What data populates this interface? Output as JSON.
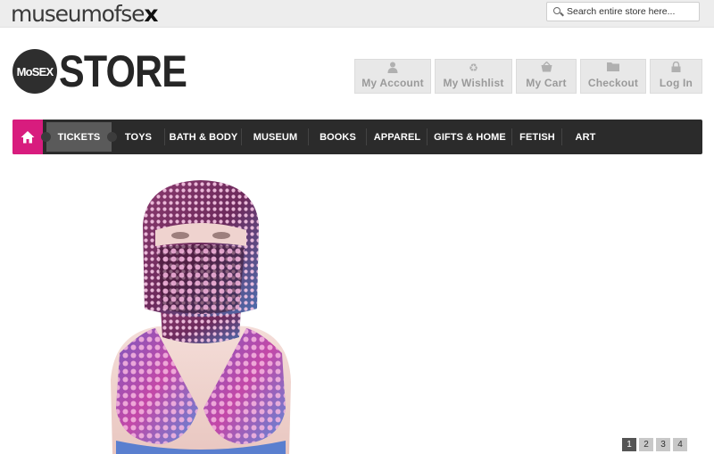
{
  "header": {
    "wordmark_main": "museumofse",
    "wordmark_x": "x",
    "search_placeholder": "Search entire store here..."
  },
  "logo": {
    "badge": "MoSEX",
    "title": "STORE"
  },
  "account_links": [
    {
      "label": "My Account",
      "icon": "person-icon"
    },
    {
      "label": "My Wishlist",
      "icon": "recycle-icon"
    },
    {
      "label": "My Cart",
      "icon": "basket-icon"
    },
    {
      "label": "Checkout",
      "icon": "folder-icon"
    },
    {
      "label": "Log In",
      "icon": "lock-icon"
    }
  ],
  "nav": {
    "items": [
      "TICKETS",
      "TOYS",
      "BATH & BODY",
      "MUSEUM",
      "BOOKS",
      "APPAREL",
      "GIFTS & HOME",
      "FETISH",
      "ART"
    ]
  },
  "colors": {
    "accent": "#d81c7e",
    "nav_bg": "#2b2b2b"
  },
  "pagination": {
    "pages": [
      "1",
      "2",
      "3",
      "4"
    ],
    "current": 1
  }
}
